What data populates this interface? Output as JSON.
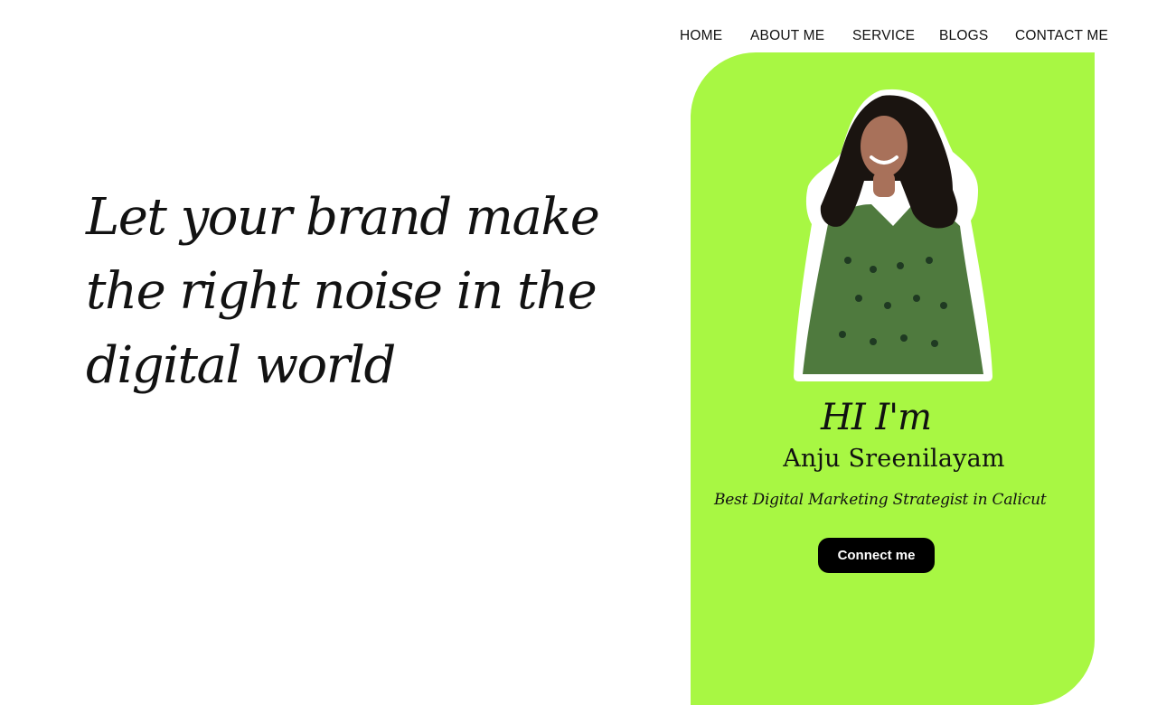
{
  "nav": {
    "items": [
      {
        "label": "HOME"
      },
      {
        "label": "ABOUT ME"
      },
      {
        "label": "SERVICE"
      },
      {
        "label": "BLOGS"
      },
      {
        "label": "CONTACT ME"
      }
    ]
  },
  "hero": {
    "headline": "Let your brand make the right noise in the digital world"
  },
  "profile": {
    "greeting": "HI I'm",
    "name": "Anju Sreenilayam",
    "tagline": "Best Digital Marketing Strategist in Calicut",
    "cta_label": "Connect me",
    "photo_icon": "person-photo",
    "colors": {
      "card_background": "#a8f743",
      "button_background": "#000000",
      "button_text": "#ffffff",
      "outfit_green": "#4f7a3e",
      "hair": "#1a1410"
    }
  }
}
